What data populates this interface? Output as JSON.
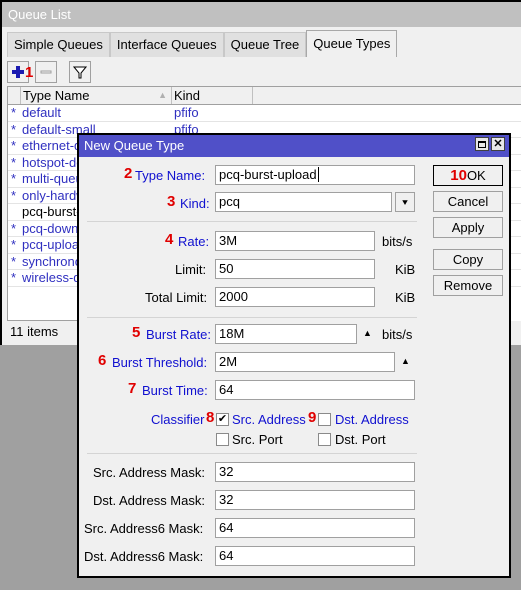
{
  "queue_list": {
    "title": "Queue List",
    "tabs": [
      {
        "label": "Simple Queues",
        "active": false
      },
      {
        "label": "Interface Queues",
        "active": false
      },
      {
        "label": "Queue Tree",
        "active": false
      },
      {
        "label": "Queue Types",
        "active": true
      }
    ],
    "toolbar": {
      "add": "+",
      "remove": "−",
      "filter": "filter",
      "annotation": "1"
    },
    "columns": [
      "",
      "Type Name",
      "Kind"
    ],
    "rows": [
      {
        "flag": "*",
        "name": "default",
        "kind": "pfifo"
      },
      {
        "flag": "*",
        "name": "default-small",
        "kind": "pfifo"
      },
      {
        "flag": "*",
        "name": "ethernet-default",
        "kind": ""
      },
      {
        "flag": "*",
        "name": "hotspot-default",
        "kind": ""
      },
      {
        "flag": "*",
        "name": "multi-queue-ethernet-default",
        "kind": ""
      },
      {
        "flag": "*",
        "name": "only-hardware-queue",
        "kind": ""
      },
      {
        "flag": "",
        "name": "pcq-burst-upload",
        "kind": ""
      },
      {
        "flag": "*",
        "name": "pcq-download-default",
        "kind": ""
      },
      {
        "flag": "*",
        "name": "pcq-upload-default",
        "kind": ""
      },
      {
        "flag": "*",
        "name": "synchronous-default",
        "kind": ""
      },
      {
        "flag": "*",
        "name": "wireless-default",
        "kind": ""
      }
    ],
    "status": "11 items"
  },
  "dialog": {
    "title": "New Queue Type",
    "fields": {
      "type_name": {
        "label": "Type Name:",
        "value": "pcq-burst-upload",
        "annotation": "2"
      },
      "kind": {
        "label": "Kind:",
        "value": "pcq",
        "annotation": "3"
      },
      "rate": {
        "label": "Rate:",
        "value": "3M",
        "unit": "bits/s",
        "annotation": "4"
      },
      "limit": {
        "label": "Limit:",
        "value": "50",
        "unit": "KiB"
      },
      "total_limit": {
        "label": "Total Limit:",
        "value": "2000",
        "unit": "KiB"
      },
      "burst_rate": {
        "label": "Burst Rate:",
        "value": "18M",
        "unit": "bits/s",
        "annotation": "5"
      },
      "burst_threshold": {
        "label": "Burst Threshold:",
        "value": "2M",
        "annotation": "6"
      },
      "burst_time": {
        "label": "Burst Time:",
        "value": "64",
        "annotation": "7"
      },
      "src_address_mask": {
        "label": "Src. Address Mask:",
        "value": "32"
      },
      "dst_address_mask": {
        "label": "Dst. Address Mask:",
        "value": "32"
      },
      "src_address6_mask": {
        "label": "Src. Address6 Mask:",
        "value": "64"
      },
      "dst_address6_mask": {
        "label": "Dst. Address6 Mask:",
        "value": "64"
      }
    },
    "classifier": {
      "label": "Classifier",
      "annotation_src": "8",
      "annotation_dst": "9",
      "options": [
        {
          "label": "Src. Address",
          "checked": true
        },
        {
          "label": "Dst. Address",
          "checked": false
        },
        {
          "label": "Src. Port",
          "checked": false
        },
        {
          "label": "Dst. Port",
          "checked": false
        }
      ]
    },
    "buttons": {
      "ok": "OK",
      "ok_annotation": "10",
      "cancel": "Cancel",
      "apply": "Apply",
      "copy": "Copy",
      "remove": "Remove"
    }
  }
}
